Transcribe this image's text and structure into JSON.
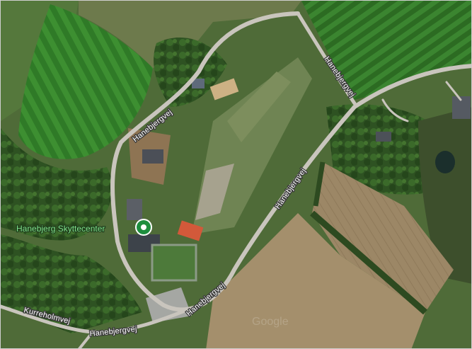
{
  "map": {
    "view": "satellite",
    "poi": {
      "name": "Hanebjerg Skyttecenter",
      "marker_color": "#1e8e3e",
      "icon": "map-pin-icon"
    },
    "road_labels": {
      "hanebjergvej_north": "Hanebjergvej",
      "hanebjergvej_northwest": "Hanebjergvej",
      "hanebjergvej_center": "Hanebjergvej",
      "hanebjergvej_south": "Hanebjergvej",
      "hanebjergvej_bottom": "Hanebjergvej",
      "kurreholmvej": "Kurreholmvej"
    },
    "watermark": "Google"
  }
}
